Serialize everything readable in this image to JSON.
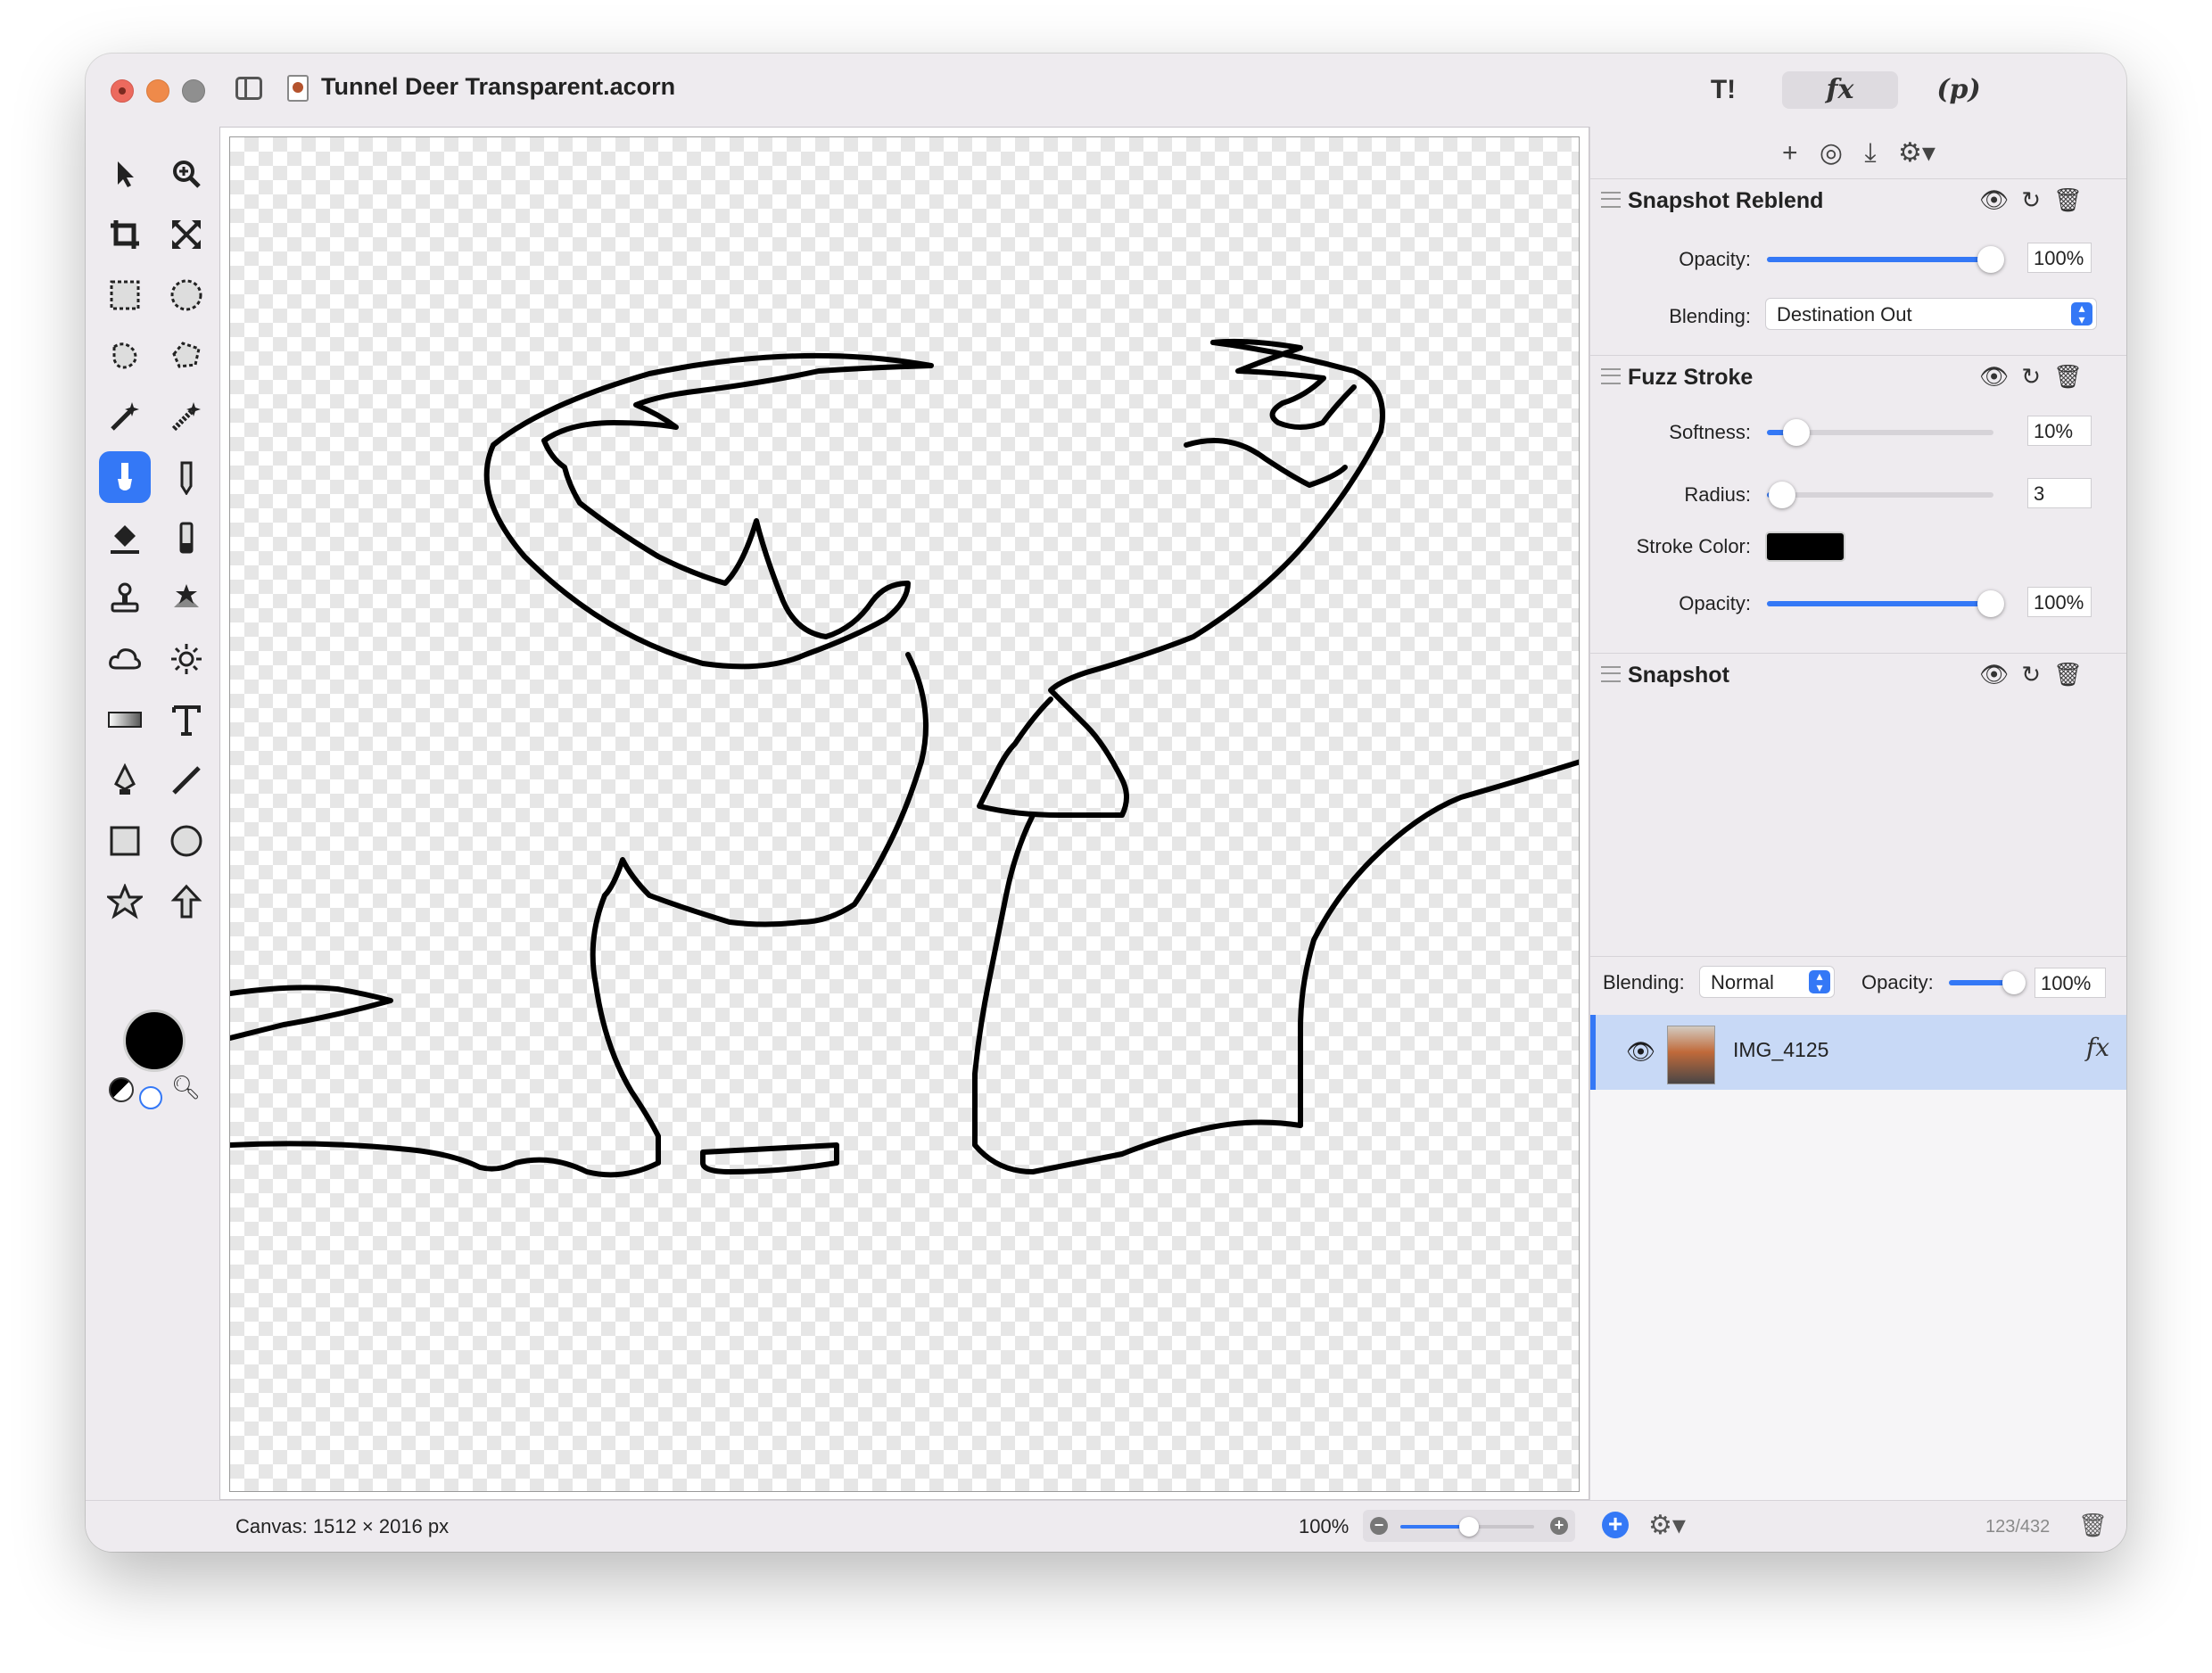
{
  "window": {
    "title": "Tunnel Deer Transparent.acorn",
    "toolbar_tabs": {
      "tools": "T!",
      "fx": "fx",
      "p": "(p)"
    }
  },
  "tools": [
    {
      "name": "arrow-tool-icon"
    },
    {
      "name": "zoom-tool-icon"
    },
    {
      "name": "crop-tool-icon"
    },
    {
      "name": "resize-tool-icon"
    },
    {
      "name": "rect-select-icon"
    },
    {
      "name": "ellipse-select-icon"
    },
    {
      "name": "lasso-icon"
    },
    {
      "name": "polygon-lasso-icon"
    },
    {
      "name": "magic-wand-icon"
    },
    {
      "name": "instant-alpha-icon"
    },
    {
      "name": "brush-tool-icon"
    },
    {
      "name": "pencil-tool-icon"
    },
    {
      "name": "paint-bucket-icon"
    },
    {
      "name": "eraser-icon"
    },
    {
      "name": "stamp-icon"
    },
    {
      "name": "smudge-icon"
    },
    {
      "name": "burn-icon"
    },
    {
      "name": "dodge-icon"
    },
    {
      "name": "gradient-icon"
    },
    {
      "name": "text-tool-icon"
    },
    {
      "name": "pen-tool-icon"
    },
    {
      "name": "line-tool-icon"
    },
    {
      "name": "rect-shape-icon"
    },
    {
      "name": "oval-shape-icon"
    },
    {
      "name": "star-shape-icon"
    },
    {
      "name": "arrow-shape-icon"
    }
  ],
  "colors": {
    "accent": "#3478f6",
    "foreground": "#000000",
    "stroke_color": "#000000"
  },
  "filters": {
    "actions": [
      "+",
      "◎",
      "⤓",
      "⚙▾"
    ],
    "snapshot_reblend": {
      "title": "Snapshot Reblend",
      "opacity_label": "Opacity:",
      "opacity_value": "100%",
      "opacity_level": 1.0,
      "blending_label": "Blending:",
      "blending_value": "Destination Out"
    },
    "fuzz_stroke": {
      "title": "Fuzz Stroke",
      "softness_label": "Softness:",
      "softness_value": "10%",
      "softness_level": 0.1,
      "radius_label": "Radius:",
      "radius_value": "3",
      "stroke_color_label": "Stroke Color:",
      "opacity_label": "Opacity:",
      "opacity_value": "100%",
      "opacity_level": 1.0
    },
    "snapshot": {
      "title": "Snapshot"
    }
  },
  "layers": {
    "blending_label": "Blending:",
    "blending_value": "Normal",
    "opacity_label": "Opacity:",
    "opacity_value": "100%",
    "items": [
      {
        "name": "IMG_4125",
        "fx": "fx"
      }
    ]
  },
  "status": {
    "canvas": "Canvas: 1512 × 2016 px",
    "zoom": "100%",
    "zoom_level": 0.5,
    "layer_count": "123/432"
  }
}
